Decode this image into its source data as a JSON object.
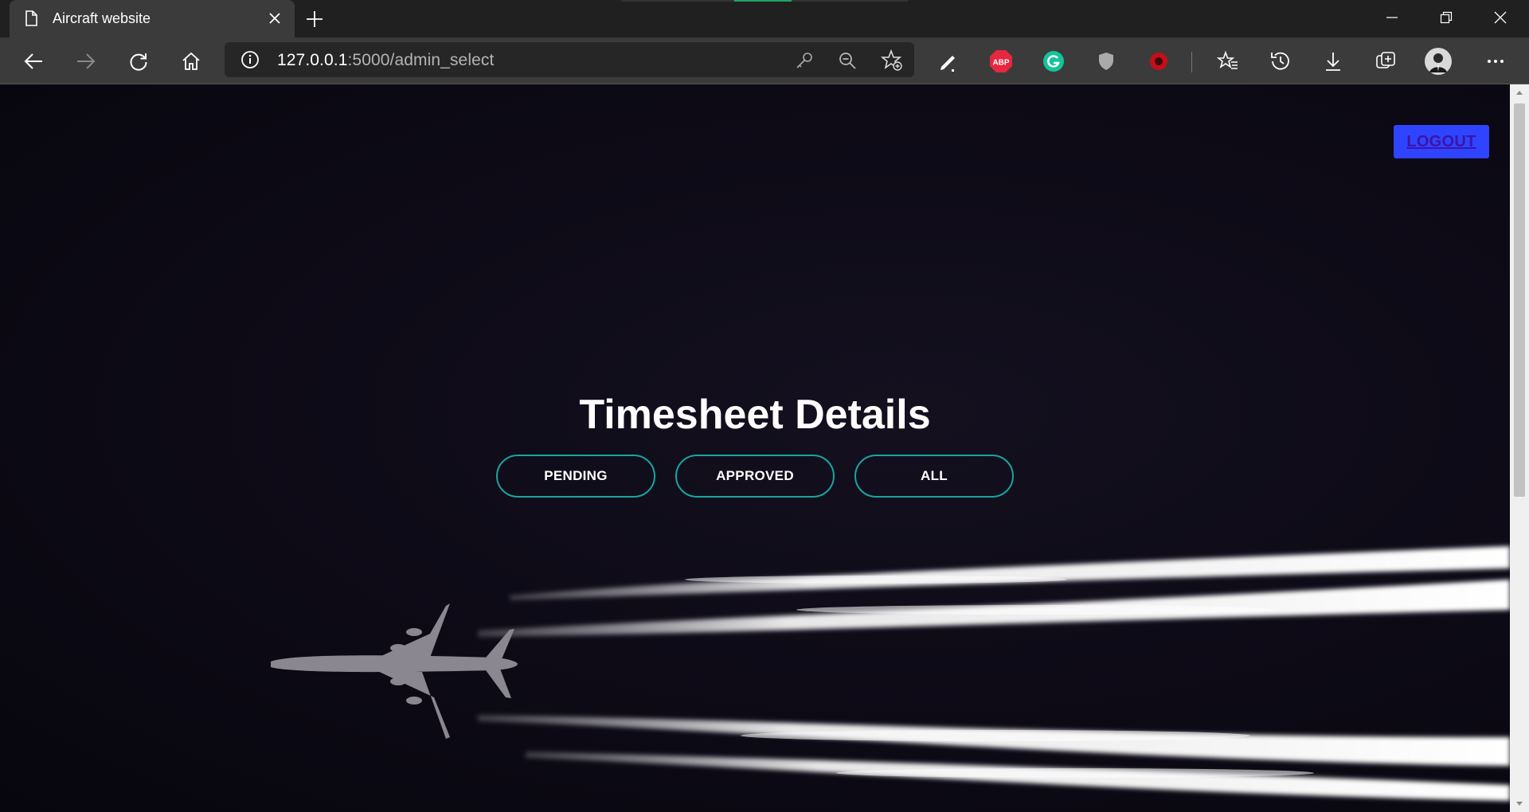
{
  "browser": {
    "tab_title": "Aircraft website",
    "url_host": "127.0.0.1",
    "url_rest": ":5000/admin_select",
    "extensions": [
      "pen-icon",
      "adblock-plus-icon",
      "grammarly-icon",
      "shield-icon",
      "recorder-icon"
    ],
    "accent_colors": {
      "loading_bar": "#1fa463",
      "abp": "#e7263f",
      "grammarly": "#15c39a"
    }
  },
  "page": {
    "logout_label": "LOGOUT",
    "heading": "Timesheet Details",
    "filters": [
      {
        "label": "PENDING"
      },
      {
        "label": "APPROVED"
      },
      {
        "label": "ALL"
      }
    ],
    "colors": {
      "logout_bg": "#2f44ff",
      "filter_border": "#17a6a0",
      "background": "#0d0a16"
    }
  }
}
